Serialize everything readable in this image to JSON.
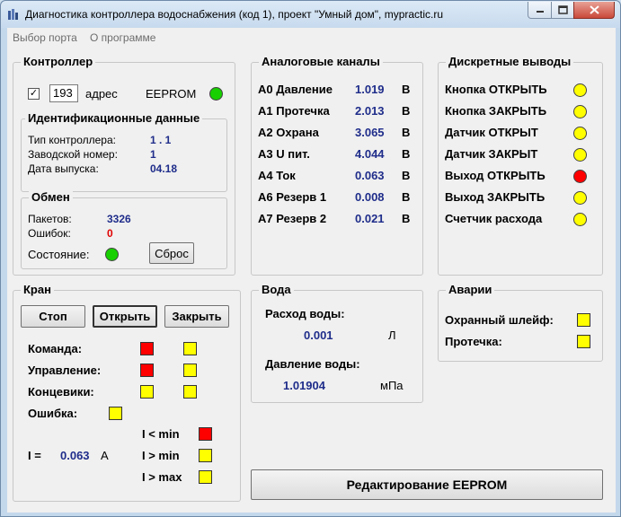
{
  "window": {
    "title": "Диагностика контроллера водоснабжения (код 1), проект \"Умный дом\", mypractic.ru"
  },
  "menu": {
    "items": [
      "Выбор порта",
      "О программе"
    ]
  },
  "controller": {
    "title": "Контроллер",
    "address_value": "193",
    "address_label": "адрес",
    "eeprom_label": "EEPROM",
    "id_data": {
      "title": "Идентификационные данные",
      "type_label": "Тип контроллера:",
      "type_value": "1 . 1",
      "serial_label": "Заводской номер:",
      "serial_value": "1",
      "date_label": "Дата выпуска:",
      "date_value": "04.18"
    },
    "exchange": {
      "title": "Обмен",
      "packets_label": "Пакетов:",
      "packets_value": "3326",
      "errors_label": "Ошибок:",
      "errors_value": "0",
      "state_label": "Состояние:",
      "reset_label": "Сброс"
    }
  },
  "analog": {
    "title": "Аналоговые каналы",
    "channels": [
      {
        "name": "A0 Давление",
        "value": "1.019",
        "unit": "В"
      },
      {
        "name": "A1 Протечка",
        "value": "2.013",
        "unit": "В"
      },
      {
        "name": "A2 Охрана",
        "value": "3.065",
        "unit": "В"
      },
      {
        "name": "A3 U пит.",
        "value": "4.044",
        "unit": "В"
      },
      {
        "name": "A4 Ток",
        "value": "0.063",
        "unit": "В"
      },
      {
        "name": "A6 Резерв 1",
        "value": "0.008",
        "unit": "В"
      },
      {
        "name": "A7 Резерв 2",
        "value": "0.021",
        "unit": "В"
      }
    ]
  },
  "discrete": {
    "title": "Дискретные выводы",
    "outputs": [
      {
        "label": "Кнопка ОТКРЫТЬ",
        "color": "yellow"
      },
      {
        "label": "Кнопка ЗАКРЫТЬ",
        "color": "yellow"
      },
      {
        "label": "Датчик ОТКРЫТ",
        "color": "yellow"
      },
      {
        "label": "Датчик ЗАКРЫТ",
        "color": "yellow"
      },
      {
        "label": "Выход ОТКРЫТЬ",
        "color": "red"
      },
      {
        "label": "Выход ЗАКРЫТЬ",
        "color": "yellow"
      },
      {
        "label": "Счетчик расхода",
        "color": "yellow"
      }
    ]
  },
  "valve": {
    "title": "Кран",
    "stop_label": "Стоп",
    "open_label": "Открыть",
    "close_label": "Закрыть",
    "command_label": "Команда:",
    "control_label": "Управление:",
    "limits_label": "Концевики:",
    "error_label": "Ошибка:",
    "current_label": "I =",
    "current_value": "0.063",
    "current_unit": "А",
    "i_min_label": "I < min",
    "i_gt_min_label": "I > min",
    "i_max_label": "I > max"
  },
  "water": {
    "title": "Вода",
    "flow_label": "Расход воды:",
    "flow_value": "0.001",
    "flow_unit": "Л",
    "pressure_label": "Давление воды:",
    "pressure_value": "1.01904",
    "pressure_unit": "мПа"
  },
  "alarms": {
    "title": "Аварии",
    "guard_label": "Охранный шлейф:",
    "leak_label": "Протечка:"
  },
  "eeprom_edit_label": "Редактирование EEPROM"
}
